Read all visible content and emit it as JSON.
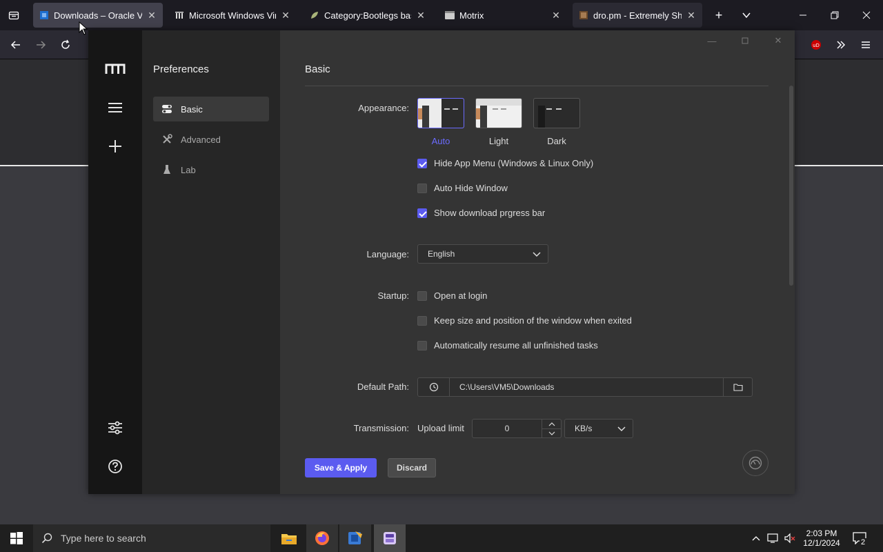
{
  "browser": {
    "tabs": [
      {
        "title": "Downloads – Oracle Virtu",
        "active": true
      },
      {
        "title": "Microsoft Windows Virtua",
        "active": false
      },
      {
        "title": "Category:Bootlegs based",
        "active": false
      },
      {
        "title": "Motrix",
        "active": false
      },
      {
        "title": "dro.pm - Extremely Short",
        "active": false
      }
    ],
    "new_tab_symbol": "+"
  },
  "app": {
    "preferences_title": "Preferences",
    "subnav": [
      {
        "label": "Basic",
        "icon": "toggle-icon",
        "active": true
      },
      {
        "label": "Advanced",
        "icon": "tools-icon",
        "active": false
      },
      {
        "label": "Lab",
        "icon": "flask-icon",
        "active": false
      }
    ],
    "section_title": "Basic",
    "appearance": {
      "label": "Appearance:",
      "themes": [
        {
          "label": "Auto",
          "selected": true
        },
        {
          "label": "Light",
          "selected": false
        },
        {
          "label": "Dark",
          "selected": false
        }
      ],
      "options": [
        {
          "label": "Hide App Menu (Windows & Linux Only)",
          "checked": true
        },
        {
          "label": "Auto Hide Window",
          "checked": false
        },
        {
          "label": "Show download prgress bar",
          "checked": true
        }
      ]
    },
    "language": {
      "label": "Language:",
      "value": "English"
    },
    "startup": {
      "label": "Startup:",
      "options": [
        {
          "label": "Open at login",
          "checked": false
        },
        {
          "label": "Keep size and position of the window when exited",
          "checked": false
        },
        {
          "label": "Automatically resume all unfinished tasks",
          "checked": false
        }
      ]
    },
    "default_path": {
      "label": "Default Path:",
      "value": "C:\\Users\\VM5\\Downloads"
    },
    "transmission": {
      "label": "Transmission:",
      "upload_label": "Upload limit",
      "upload_value": "0",
      "unit": "KB/s"
    },
    "buttons": {
      "save": "Save & Apply",
      "discard": "Discard"
    },
    "accent": "#5b5bf0"
  },
  "taskbar": {
    "search_placeholder": "Type here to search",
    "time": "2:03 PM",
    "date": "12/1/2024",
    "notification_count": "2"
  }
}
